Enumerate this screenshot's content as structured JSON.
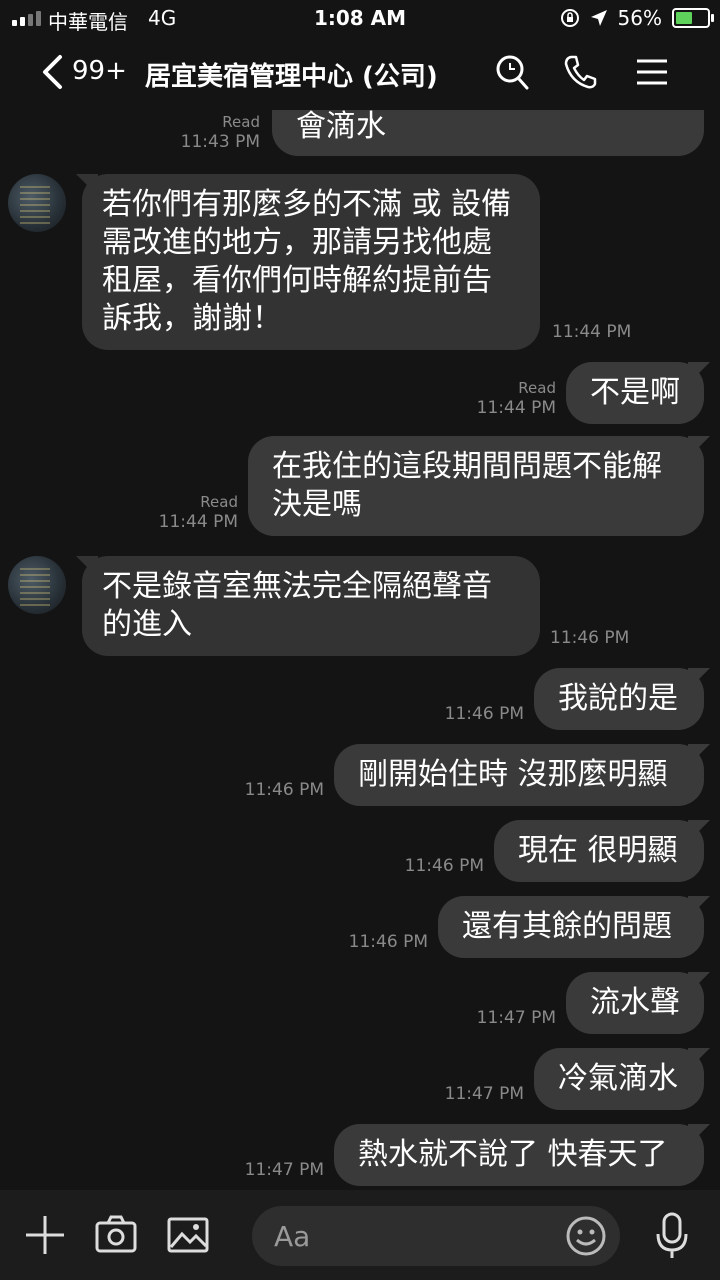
{
  "status_bar": {
    "carrier": "中華電信",
    "network": "4G",
    "time": "1:08 AM",
    "battery": "56%",
    "battery_level": 0.56
  },
  "header": {
    "unread_count": "99+",
    "title": "居宜美宿管理中心 (公司)"
  },
  "messages": [
    {
      "side": "out",
      "text": "會滴水",
      "read": "Read",
      "time": "11:43 PM"
    },
    {
      "side": "in",
      "text": "若你們有那麼多的不滿 或 設備需改進的地方，那請另找他處租屋，看你們何時解約提前告訴我，謝謝！",
      "time": "11:44 PM"
    },
    {
      "side": "out",
      "text": "不是啊",
      "read": "Read",
      "time": "11:44 PM"
    },
    {
      "side": "out",
      "text": "在我住的這段期間問題不能解決是嗎",
      "read": "Read",
      "time": "11:44 PM"
    },
    {
      "side": "in",
      "text": "不是錄音室無法完全隔絕聲音的進入",
      "time": "11:46 PM"
    },
    {
      "side": "out",
      "text": "我說的是",
      "time": "11:46 PM"
    },
    {
      "side": "out",
      "text": "剛開始住時 沒那麼明顯",
      "time": "11:46 PM"
    },
    {
      "side": "out",
      "text": "現在 很明顯",
      "time": "11:46 PM"
    },
    {
      "side": "out",
      "text": "還有其餘的問題",
      "time": "11:46 PM"
    },
    {
      "side": "out",
      "text": "流水聲",
      "time": "11:47 PM"
    },
    {
      "side": "out",
      "text": "冷氣滴水",
      "time": "11:47 PM"
    },
    {
      "side": "out",
      "text": "熱水就不說了 快春天了",
      "time": "11:47 PM"
    }
  ],
  "input": {
    "placeholder": "Aa"
  },
  "colors": {
    "background": "#141414",
    "bubble_in": "#333333",
    "bubble_out": "#3a3a3a",
    "battery": "#5ed25b"
  },
  "icons": [
    "back-chevron-icon",
    "search-icon",
    "phone-icon",
    "menu-icon",
    "plus-icon",
    "camera-icon",
    "image-icon",
    "emoji-icon",
    "microphone-icon"
  ]
}
